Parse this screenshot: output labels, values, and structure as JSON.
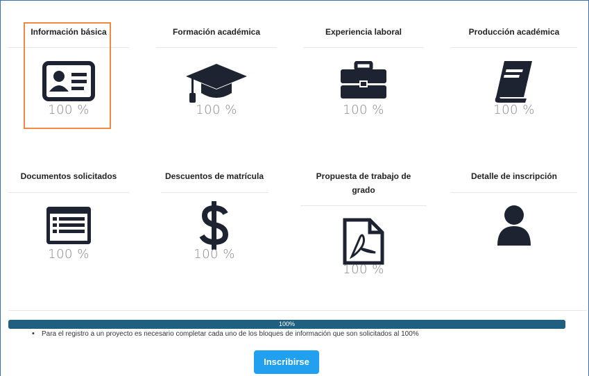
{
  "blocks": [
    {
      "title": "Información básica",
      "percent": "100 %",
      "icon": "id-card-icon"
    },
    {
      "title": "Formación académica",
      "percent": "100 %",
      "icon": "graduation-cap-icon"
    },
    {
      "title": "Experiencia laboral",
      "percent": "100 %",
      "icon": "briefcase-icon"
    },
    {
      "title": "Producción académica",
      "percent": "100 %",
      "icon": "book-icon"
    },
    {
      "title": "Documentos solicitados",
      "percent": "100 %",
      "icon": "list-document-icon"
    },
    {
      "title": "Descuentos de matrícula",
      "percent": "100 %",
      "icon": "dollar-icon"
    },
    {
      "title_line1": "Propuesta de trabajo de",
      "title_line2": "grado",
      "percent": "100 %",
      "icon": "pdf-file-icon"
    },
    {
      "title": "Detalle de inscripción",
      "icon": "user-icon"
    }
  ],
  "progress": {
    "label": "100%",
    "value": 1.0
  },
  "note": "Para el registro a un proyecto es necesario completar cada uno de los bloques de información que son solicitados al 100%",
  "submit_label": "Inscribirse",
  "colors": {
    "icon": "#1d2330",
    "highlight": "#f0883e",
    "progress": "#1f5f7f",
    "button": "#21a0ef"
  }
}
